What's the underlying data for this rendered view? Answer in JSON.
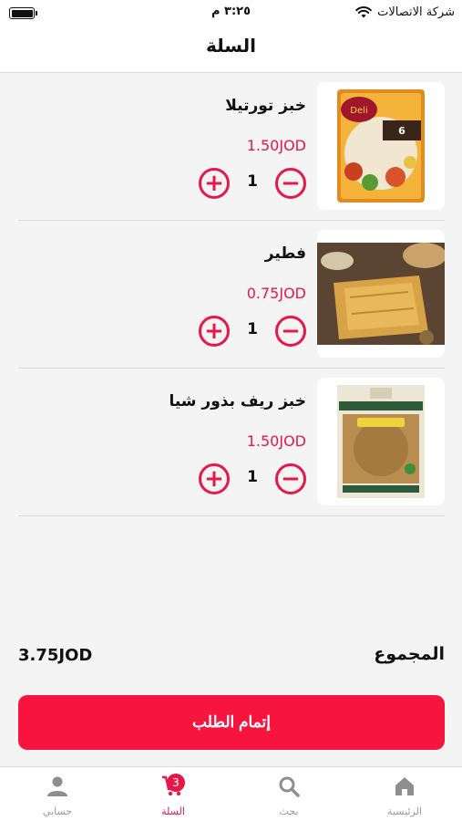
{
  "status_bar": {
    "carrier": "شركة الاتصالات",
    "time": "٣:٢٥ م"
  },
  "header": {
    "title": "السلة"
  },
  "cart": {
    "items": [
      {
        "name": "خبز تورتيلا",
        "price": "1.50JOD",
        "quantity": "1",
        "image_icon": "tortilla-wraps-package-image"
      },
      {
        "name": "فطير",
        "price": "0.75JOD",
        "quantity": "1",
        "image_icon": "pastry-photo-image"
      },
      {
        "name": "خبز ريف بذور شيا",
        "price": "1.50JOD",
        "quantity": "1",
        "image_icon": "reef-bread-package-image"
      }
    ]
  },
  "summary": {
    "total_label": "المجموع",
    "total_value": "3.75JOD"
  },
  "checkout_label": "إتمام الطلب",
  "tab_bar": {
    "tabs": [
      {
        "label": "الرئيسية",
        "icon": "home-icon",
        "active": false
      },
      {
        "label": "بحث",
        "icon": "search-icon",
        "active": false
      },
      {
        "label": "السلة",
        "icon": "cart-icon",
        "active": true,
        "badge": "3"
      },
      {
        "label": "حسابي",
        "icon": "user-icon",
        "active": false
      }
    ]
  },
  "colors": {
    "accent": "#e8174a",
    "button": "#f7153f",
    "inactive": "#999999"
  }
}
